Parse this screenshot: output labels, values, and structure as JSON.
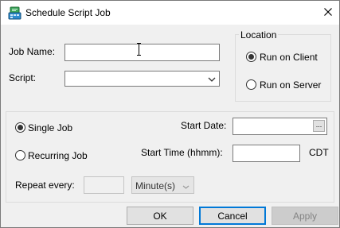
{
  "window": {
    "title": "Schedule Script Job",
    "icon": "script-job-icon",
    "close_icon": "close-icon"
  },
  "form": {
    "job_name_label": "Job Name:",
    "job_name_value": "",
    "script_label": "Script:",
    "script_value": ""
  },
  "location": {
    "legend": "Location",
    "run_on_client_label": "Run on Client",
    "run_on_server_label": "Run on Server",
    "selected": "Run on Client"
  },
  "schedule": {
    "single_job_label": "Single Job",
    "recurring_job_label": "Recurring Job",
    "selected": "Single Job",
    "start_date_label": "Start Date:",
    "start_date_value": "",
    "start_date_button": "...",
    "start_time_label": "Start Time (hhmm):",
    "start_time_value": "",
    "timezone": "CDT",
    "repeat_every_label": "Repeat every:",
    "repeat_every_value": "",
    "repeat_unit": "Minute(s)"
  },
  "buttons": {
    "ok": "OK",
    "cancel": "Cancel",
    "apply": "Apply"
  },
  "colors": {
    "dialog_bg": "#f0f0f0",
    "focus_accent": "#0078d7",
    "disabled_text": "#838383"
  }
}
